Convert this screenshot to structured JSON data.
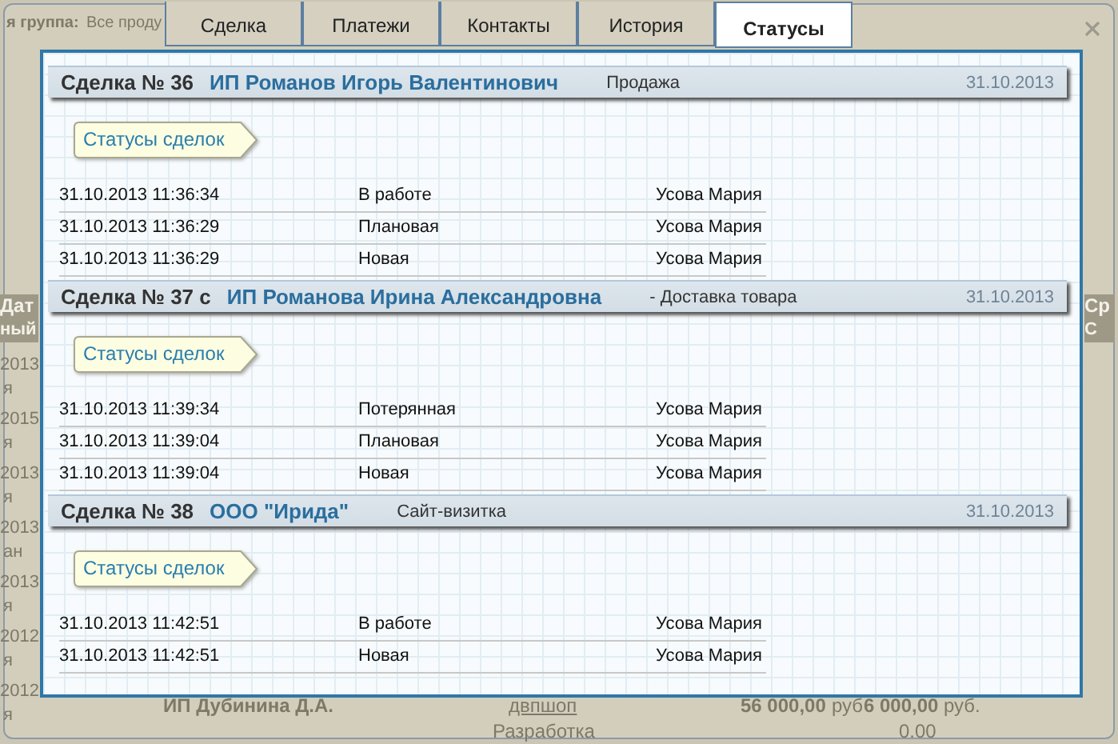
{
  "backdrop": {
    "group_label": "я группа:",
    "group_value": "Все проду",
    "left_header": [
      "Дат",
      "ный"
    ],
    "right_header": [
      "Ср",
      "С"
    ],
    "left_column": [
      "2013",
      "я",
      "2015",
      "я",
      "2013",
      "я",
      "2013",
      "ан",
      "2013",
      "я",
      "2012",
      "я",
      "2012",
      "я"
    ],
    "bottom_row": {
      "client": "ИП Дубинина Д.А.",
      "link": "двпшоп",
      "type": "Разработка",
      "amount_1": "56 000,00",
      "currency_1": "руб",
      "amount_2": "6 000,00",
      "currency_2": "руб.",
      "value": "0.00"
    }
  },
  "tabs": [
    {
      "label": "Сделка",
      "selected": false
    },
    {
      "label": "Платежи",
      "selected": false
    },
    {
      "label": "Контакты",
      "selected": false
    },
    {
      "label": "История",
      "selected": false
    },
    {
      "label": "Статусы",
      "selected": true
    }
  ],
  "deals": [
    {
      "title": "Сделка № 36",
      "client": "ИП Романов Игорь Валентинович",
      "type": "Продажа",
      "date": "31.10.2013",
      "tag": "Статусы сделок",
      "statuses": [
        {
          "time": "31.10.2013 11:36:34",
          "status": "В работе",
          "user": "Усова Мария"
        },
        {
          "time": "31.10.2013 11:36:29",
          "status": "Плановая",
          "user": "Усова Мария"
        },
        {
          "time": "31.10.2013 11:36:29",
          "status": "Новая",
          "user": "Усова Мария"
        }
      ]
    },
    {
      "title": "Сделка № 37 с",
      "client": "ИП Романова Ирина Александровна",
      "type": "- Доставка товара",
      "date": "31.10.2013",
      "tag": "Статусы сделок",
      "statuses": [
        {
          "time": "31.10.2013 11:39:34",
          "status": "Потерянная",
          "user": "Усова Мария"
        },
        {
          "time": "31.10.2013 11:39:04",
          "status": "Плановая",
          "user": "Усова Мария"
        },
        {
          "time": "31.10.2013 11:39:04",
          "status": "Новая",
          "user": "Усова Мария"
        }
      ]
    },
    {
      "title": "Сделка № 38",
      "client": "ООО \"Ирида\"",
      "type": "Сайт-визитка",
      "date": "31.10.2013",
      "tag": "Статусы сделок",
      "statuses": [
        {
          "time": "31.10.2013 11:42:51",
          "status": "В работе",
          "user": "Усова Мария"
        },
        {
          "time": "31.10.2013 11:42:51",
          "status": "Новая",
          "user": "Усова Мария"
        }
      ]
    }
  ]
}
